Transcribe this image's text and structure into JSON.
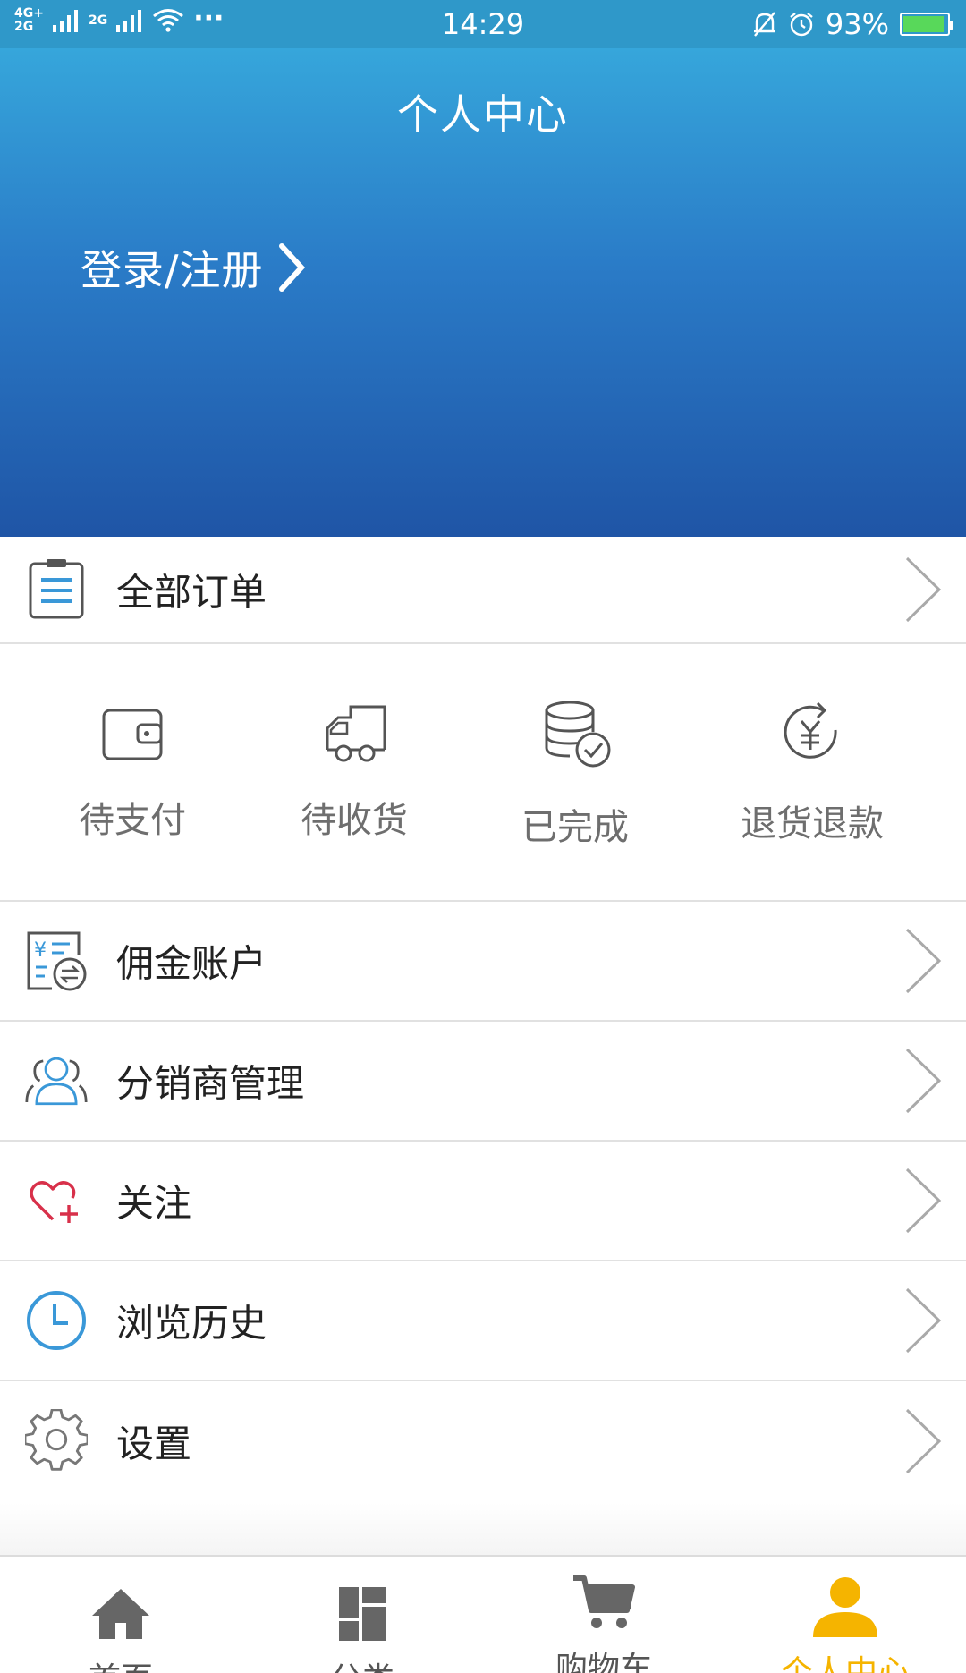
{
  "status_bar": {
    "network_top": "4G+",
    "network_bottom": "2G",
    "network2": "2G",
    "dots": "···",
    "time": "14:29",
    "battery_percent": "93%",
    "battery_level": 0.93
  },
  "header": {
    "title": "个人中心",
    "login_label": "登录/注册"
  },
  "orders": {
    "all_orders_label": "全部订单",
    "statuses": [
      {
        "label": "待支付",
        "icon": "wallet-icon"
      },
      {
        "label": "待收货",
        "icon": "truck-icon"
      },
      {
        "label": "已完成",
        "icon": "database-check-icon"
      },
      {
        "label": "退货退款",
        "icon": "refund-icon"
      }
    ]
  },
  "menu": [
    {
      "label": "佣金账户",
      "icon": "commission-account-icon"
    },
    {
      "label": "分销商管理",
      "icon": "users-icon"
    },
    {
      "label": "关注",
      "icon": "heart-plus-icon"
    },
    {
      "label": "浏览历史",
      "icon": "clock-icon"
    },
    {
      "label": "设置",
      "icon": "gear-icon"
    }
  ],
  "tabs": [
    {
      "label": "首页",
      "icon": "home-icon"
    },
    {
      "label": "分类",
      "icon": "category-icon"
    },
    {
      "label": "购物车",
      "icon": "cart-icon"
    },
    {
      "label": "个人中心",
      "icon": "user-icon",
      "active": true
    }
  ],
  "colors": {
    "header_top": "#36a6db",
    "header_bottom": "#1f55a6",
    "active_tab": "#f5b400",
    "accent_blue": "#3a98d8",
    "heart_red": "#d8304a"
  }
}
